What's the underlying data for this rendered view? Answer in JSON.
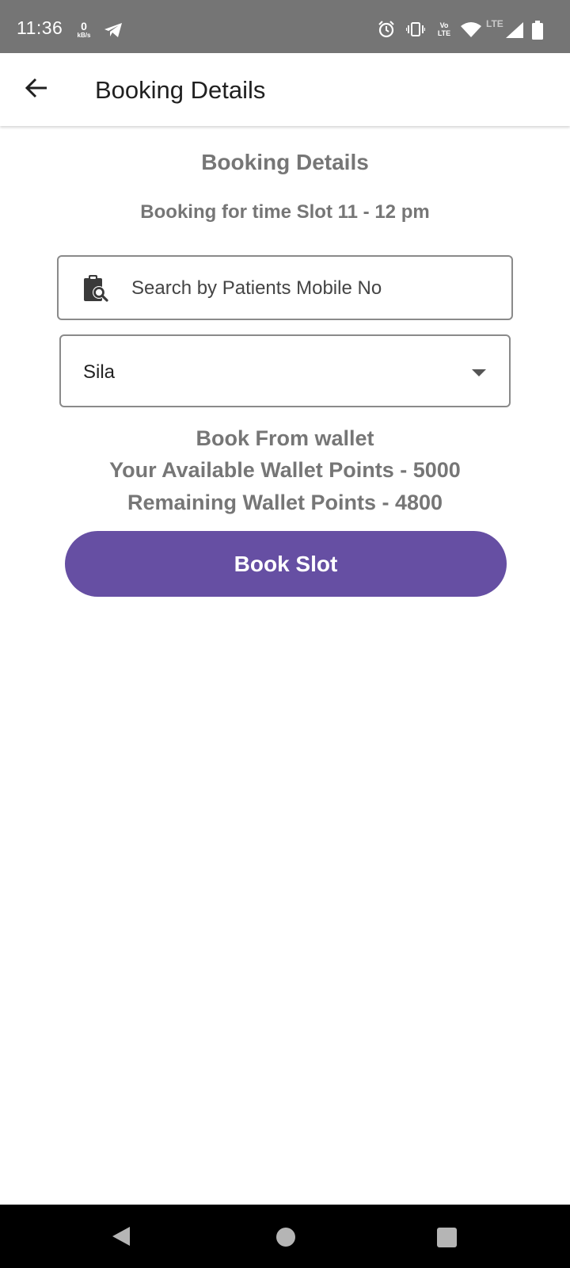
{
  "status_bar": {
    "time": "11:36",
    "net_speed_value": "0",
    "net_speed_unit": "kB/s",
    "volte_line1": "Vo",
    "volte_line2": "LTE",
    "lte_label": "LTE",
    "icons": [
      "telegram-icon",
      "alarm-icon",
      "vibrate-icon",
      "volte-icon",
      "wifi-icon",
      "signal-icon",
      "battery-icon"
    ]
  },
  "app_bar": {
    "title": "Booking Details",
    "back_icon": "arrow-back-icon"
  },
  "content": {
    "heading": "Booking Details",
    "slot_text": "Booking for time Slot 11 - 12 pm",
    "search": {
      "placeholder": "Search by Patients Mobile No",
      "icon": "clipboard-search-icon"
    },
    "dropdown": {
      "selected": "Sila",
      "icon": "caret-down-icon"
    },
    "wallet": {
      "line1": "Book From wallet",
      "line2": "Your Available Wallet Points - 5000",
      "line3": "Remaining Wallet Points - 4800"
    },
    "book_button": "Book Slot",
    "accent_color": "#664fa3"
  },
  "nav_bar": {
    "icons": [
      "nav-back-icon",
      "nav-home-icon",
      "nav-recents-icon"
    ]
  }
}
